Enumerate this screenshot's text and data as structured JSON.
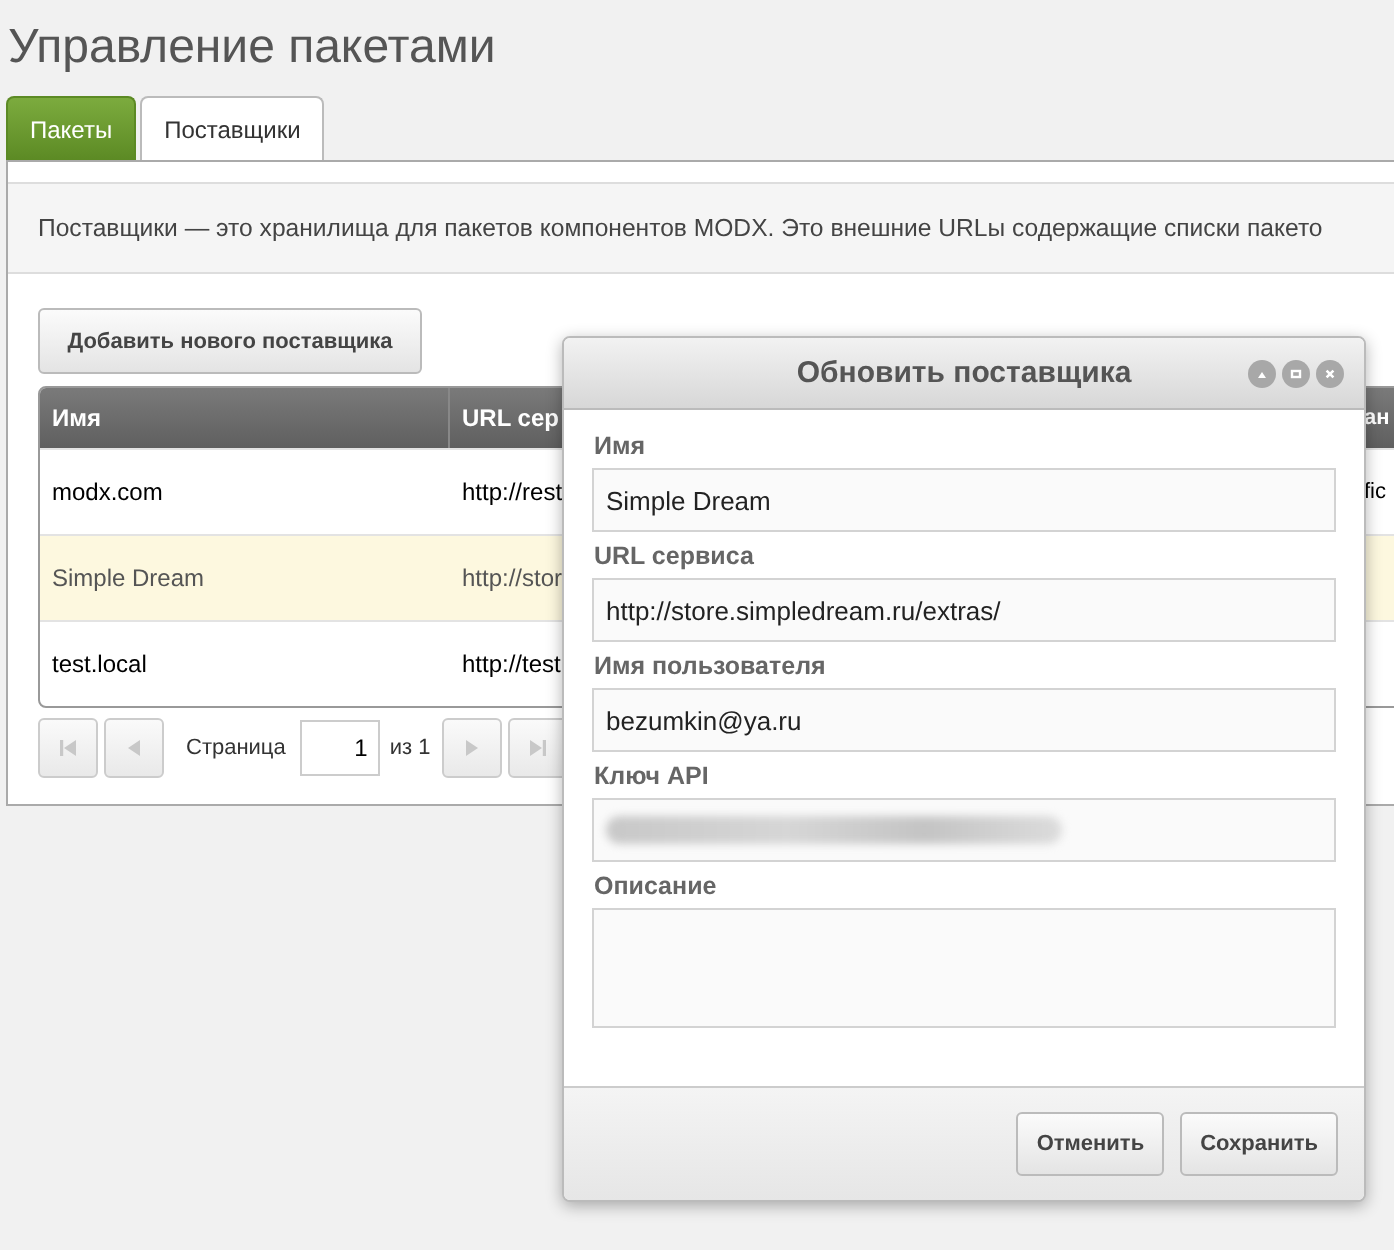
{
  "page": {
    "title": "Управление пакетами"
  },
  "tabs": [
    {
      "label": "Пакеты",
      "selected": false
    },
    {
      "label": "Поставщики",
      "selected": true
    }
  ],
  "description": "Поставщики — это хранилища для пакетов компонентов MODX. Это внешние URLы содержащие списки пакето",
  "add_button": "Добавить нового поставщика",
  "table": {
    "columns": [
      "Имя",
      "URL сер",
      "ан"
    ],
    "rows": [
      {
        "cells": [
          "modx.com",
          "http://rest",
          "fic"
        ],
        "selected": false
      },
      {
        "cells": [
          "Simple Dream",
          "http://stor",
          ""
        ],
        "selected": true
      },
      {
        "cells": [
          "test.local",
          "http://test",
          ""
        ],
        "selected": false
      }
    ]
  },
  "pager": {
    "label": "Страница",
    "page": "1",
    "of": "из 1",
    "first_disabled": true,
    "prev_disabled": true,
    "next_disabled": true,
    "last_disabled": true
  },
  "dialog": {
    "title": "Обновить поставщика",
    "fields": [
      {
        "label": "Имя",
        "value": "Simple Dream",
        "kind": "text"
      },
      {
        "label": "URL сервиса",
        "value": "http://store.simpledream.ru/extras/",
        "kind": "text"
      },
      {
        "label": "Имя пользователя",
        "value": "bezumkin@ya.ru",
        "kind": "text"
      },
      {
        "label": "Ключ API",
        "redacted": true,
        "kind": "text"
      },
      {
        "label": "Описание",
        "kind": "textarea"
      }
    ],
    "buttons": [
      "Отменить",
      "Сохранить"
    ]
  }
}
